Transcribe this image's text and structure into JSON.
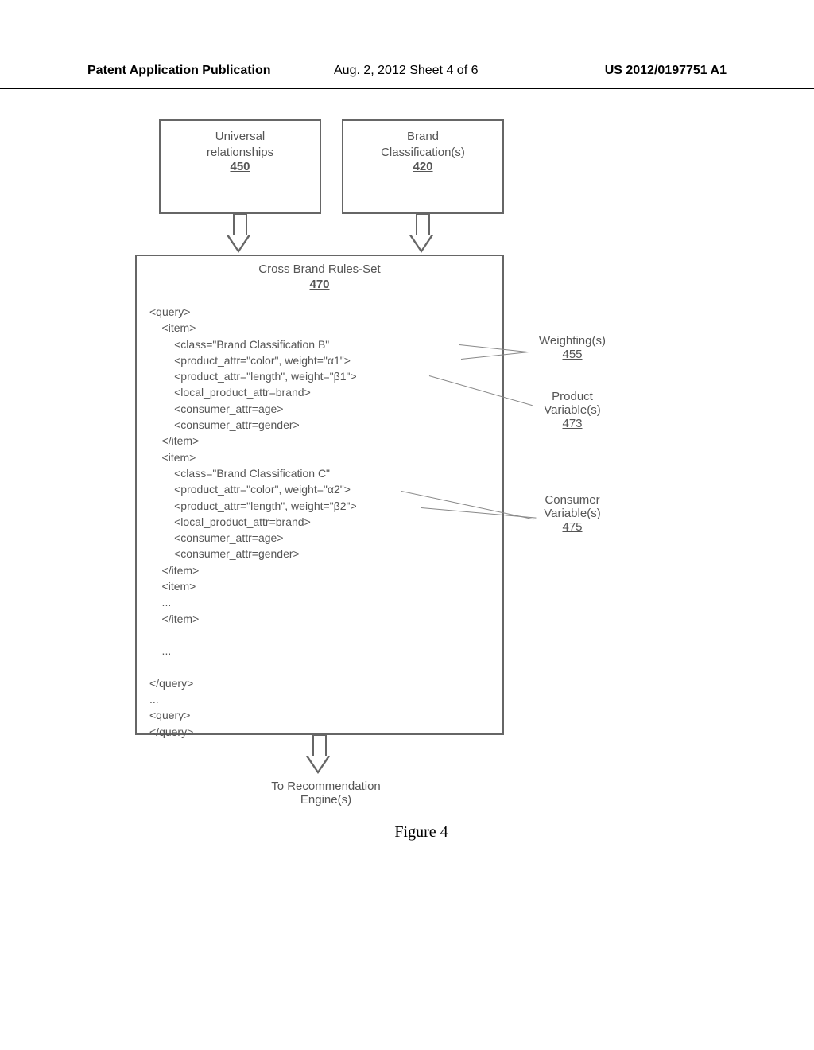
{
  "header": {
    "left": "Patent Application Publication",
    "mid": "Aug. 2, 2012  Sheet 4 of 6",
    "right": "US 2012/0197751 A1"
  },
  "boxes": {
    "topLeft": {
      "title": "Universal\nrelationships",
      "num": "450"
    },
    "topRight": {
      "title": "Brand\nClassification(s)",
      "num": "420"
    }
  },
  "main": {
    "title": "Cross Brand Rules-Set",
    "num": "470",
    "code": "<query>\n    <item>\n        <class=\"Brand Classification B\"\n        <product_attr=\"color\", weight=\"α1\">\n        <product_attr=\"length\", weight=\"β1\">\n        <local_product_attr=brand>\n        <consumer_attr=age>\n        <consumer_attr=gender>\n    </item>\n    <item>\n        <class=\"Brand Classification C\"\n        <product_attr=\"color\", weight=\"α2\">\n        <product_attr=\"length\", weight=\"β2\">\n        <local_product_attr=brand>\n        <consumer_attr=age>\n        <consumer_attr=gender>\n    </item>\n    <item>\n    ...\n    </item>\n\n    ...\n\n</query>\n...\n<query>\n</query>"
  },
  "dest": "To Recommendation\nEngine(s)",
  "figLabel": "Figure 4",
  "annots": {
    "w455": {
      "label": "Weighting(s)",
      "num": "455"
    },
    "p473": {
      "label": "Product\nVariable(s)",
      "num": "473"
    },
    "c475": {
      "label": "Consumer\nVariable(s)",
      "num": "475"
    }
  }
}
